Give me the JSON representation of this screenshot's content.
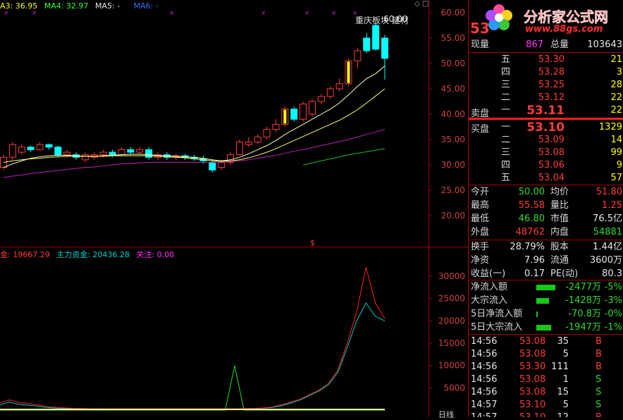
{
  "indicators_top": [
    {
      "label": "A3: 36.95",
      "color": "#ffff00"
    },
    {
      "label": "MA4: 32.97",
      "color": "#33ff33"
    },
    {
      "label": "MA5: -",
      "color": "#e6e6e6"
    },
    {
      "label": "MA6: -",
      "color": "#3b6bff"
    }
  ],
  "indicators_bottom": [
    {
      "label": "金: 19667.29",
      "color": "#ff3b3b"
    },
    {
      "label": "主力资金: 20436.28",
      "color": "#00d0d0"
    },
    {
      "label": "关注: 0.00",
      "color": "#ff33ff"
    }
  ],
  "stock_tag": "重庆板块 建材",
  "stock_tag_price": "60.00",
  "marker_symbol": "$",
  "top_axis_ticks": [
    "60.00",
    "55.00",
    "50.00",
    "45.00",
    "40.00",
    "35.00",
    "30.00",
    "25.00",
    "20.00"
  ],
  "bottom_axis_ticks": [
    "30000",
    "25000",
    "20000",
    "15000",
    "10000",
    "5000"
  ],
  "bottom_corner_label": "日线",
  "logo": {
    "title": "分析家公式网",
    "url": "www.88gs.com",
    "code_fragment": "53"
  },
  "colors": {
    "up": "#ff3b3b",
    "down": "#00ffff",
    "ma_white": "#ffffc0",
    "ma_yellow": "#ffff60",
    "ma_mag": "#c020c0",
    "ma_green": "#20c020",
    "red_line": "#ff2020",
    "cyan_line": "#00c8c8",
    "green_line": "#20e020"
  },
  "quote": {
    "xianliang_label": "现量",
    "xianliang": "867",
    "zongliang_label": "总量",
    "zongliang": "103643",
    "sell_label": "卖盘",
    "buy_label": "买盘",
    "asks": [
      {
        "level": "五",
        "price": "53.30",
        "vol": "21"
      },
      {
        "level": "四",
        "price": "53.28",
        "vol": "3"
      },
      {
        "level": "三",
        "price": "53.25",
        "vol": "28"
      },
      {
        "level": "二",
        "price": "53.12",
        "vol": "22"
      },
      {
        "level": "一",
        "price": "53.11",
        "vol": "22"
      }
    ],
    "bids": [
      {
        "level": "一",
        "price": "53.10",
        "vol": "1329"
      },
      {
        "level": "二",
        "price": "53.09",
        "vol": "14"
      },
      {
        "level": "三",
        "price": "53.08",
        "vol": "99"
      },
      {
        "level": "四",
        "price": "53.06",
        "vol": "9"
      },
      {
        "level": "五",
        "price": "53.04",
        "vol": "57"
      }
    ]
  },
  "stats": [
    {
      "l1": "今开",
      "v1": "50.00",
      "c1": "grn",
      "l2": "均价",
      "v2": "51.80",
      "c2": "red"
    },
    {
      "l1": "最高",
      "v1": "55.58",
      "c1": "red",
      "l2": "量比",
      "v2": "1.25",
      "c2": "red"
    },
    {
      "l1": "最低",
      "v1": "46.80",
      "c1": "grn",
      "l2": "市值",
      "v2": "76.5亿",
      "c2": "wht"
    },
    {
      "l1": "外盘",
      "v1": "48762",
      "c1": "red",
      "l2": "内盘",
      "v2": "54881",
      "c2": "grn"
    }
  ],
  "stats2": [
    {
      "l1": "换手",
      "v1": "28.79%",
      "l2": "股本",
      "v2": "1.44亿"
    },
    {
      "l1": "净资",
      "v1": "7.96",
      "l2": "流通",
      "v2": "3600万"
    },
    {
      "l1": "收益(一)",
      "v1": "0.17",
      "l2": "PE(动)",
      "v2": "80.3"
    }
  ],
  "flows": [
    {
      "label": "净流入额",
      "value": "-2477万",
      "pct": "-5%",
      "bar": 0.9
    },
    {
      "label": "大宗流入",
      "value": "-1428万",
      "pct": "-3%",
      "bar": 0.6
    },
    {
      "label": "5日净流入额",
      "value": "-70.8万",
      "pct": "-0%",
      "bar": 0.05
    },
    {
      "label": "5日大宗流入",
      "value": "-1947万",
      "pct": "-1%",
      "bar": 0.7
    }
  ],
  "ticks": [
    {
      "time": "14:56",
      "price": "53.08",
      "vol": "35",
      "side": "B"
    },
    {
      "time": "14:56",
      "price": "53.08",
      "vol": "5",
      "side": "B"
    },
    {
      "time": "14:56",
      "price": "53.30",
      "vol": "111",
      "side": "B"
    },
    {
      "time": "14:56",
      "price": "53.08",
      "vol": "1",
      "side": "S"
    },
    {
      "time": "14:56",
      "price": "53.08",
      "vol": "15",
      "side": "S"
    },
    {
      "time": "14:57",
      "price": "53.10",
      "vol": "5",
      "side": "S"
    },
    {
      "time": "14:57",
      "price": "53.10",
      "vol": "12",
      "side": "B"
    }
  ],
  "chart_data": {
    "type": "candlestick",
    "ylim": [
      20,
      60
    ],
    "candles": [
      [
        29.5,
        31.5,
        32.0,
        29.0
      ],
      [
        31.5,
        34.0,
        34.5,
        31.0
      ],
      [
        32.5,
        33.5,
        34.0,
        32.0
      ],
      [
        33.5,
        33.0,
        33.8,
        32.5
      ],
      [
        33.0,
        34.0,
        34.5,
        32.8
      ],
      [
        34.0,
        33.5,
        34.2,
        33.0
      ],
      [
        33.5,
        32.0,
        33.8,
        31.5
      ],
      [
        32.0,
        32.5,
        33.0,
        31.5
      ],
      [
        32.0,
        31.5,
        32.5,
        31.0
      ],
      [
        31.0,
        32.0,
        32.5,
        30.5
      ],
      [
        31.5,
        32.0,
        32.5,
        31.0
      ],
      [
        32.0,
        32.5,
        33.0,
        31.5
      ],
      [
        32.5,
        32.0,
        33.0,
        31.5
      ],
      [
        32.0,
        33.0,
        33.5,
        31.8
      ],
      [
        33.0,
        32.5,
        33.5,
        32.0
      ],
      [
        32.5,
        33.0,
        33.5,
        32.0
      ],
      [
        33.0,
        31.5,
        33.5,
        31.0
      ],
      [
        31.5,
        32.0,
        32.5,
        31.0
      ],
      [
        32.0,
        31.5,
        32.5,
        31.0
      ],
      [
        31.5,
        31.8,
        32.2,
        31.0
      ],
      [
        31.8,
        31.5,
        32.2,
        31.0
      ],
      [
        31.5,
        31.2,
        32.0,
        30.8
      ],
      [
        31.2,
        30.8,
        31.8,
        30.2
      ],
      [
        30.5,
        29.0,
        31.0,
        28.5
      ],
      [
        29.5,
        30.5,
        31.0,
        29.0
      ],
      [
        30.5,
        32.0,
        32.5,
        30.0
      ],
      [
        32.0,
        34.5,
        35.0,
        31.8
      ],
      [
        34.0,
        34.5,
        35.5,
        33.5
      ],
      [
        34.5,
        35.5,
        36.0,
        34.0
      ],
      [
        35.5,
        37.0,
        37.5,
        35.0
      ],
      [
        37.0,
        38.0,
        39.0,
        36.5
      ],
      [
        38.0,
        41.0,
        41.5,
        37.5
      ],
      [
        41.0,
        39.0,
        41.5,
        38.5
      ],
      [
        39.0,
        42.0,
        42.5,
        38.5
      ],
      [
        40.0,
        42.5,
        43.0,
        39.5
      ],
      [
        42.5,
        43.5,
        44.0,
        42.0
      ],
      [
        43.5,
        45.0,
        45.5,
        43.0
      ],
      [
        45.0,
        46.0,
        47.0,
        44.5
      ],
      [
        46.0,
        50.5,
        51.0,
        45.5
      ],
      [
        50.5,
        52.5,
        53.0,
        49.0
      ],
      [
        55.0,
        52.5,
        56.0,
        52.0
      ],
      [
        57.5,
        52.8,
        58.0,
        52.5
      ],
      [
        55.0,
        51.0,
        55.6,
        46.8
      ]
    ],
    "ma_white": [
      29.5,
      30.2,
      30.8,
      31.3,
      31.6,
      31.8,
      31.9,
      31.9,
      31.8,
      31.7,
      31.7,
      31.8,
      31.9,
      32.0,
      32.1,
      32.1,
      32.0,
      31.9,
      31.8,
      31.7,
      31.6,
      31.5,
      31.3,
      31.0,
      30.8,
      31.0,
      31.5,
      32.2,
      33.0,
      33.8,
      34.8,
      36.0,
      37.0,
      38.0,
      39.0,
      40.0,
      41.0,
      42.2,
      43.8,
      45.5,
      47.0,
      48.0,
      49.5
    ],
    "ma_yellow": [
      30.5,
      30.8,
      31.0,
      31.2,
      31.3,
      31.5,
      31.6,
      31.7,
      31.7,
      31.7,
      31.7,
      31.7,
      31.8,
      31.8,
      31.8,
      31.8,
      31.8,
      31.7,
      31.6,
      31.5,
      31.4,
      31.2,
      31.0,
      30.8,
      30.7,
      30.8,
      31.0,
      31.4,
      31.9,
      32.5,
      33.2,
      34.0,
      34.8,
      35.6,
      36.4,
      37.2,
      38.0,
      38.8,
      39.8,
      40.9,
      42.2,
      43.6,
      45.0
    ],
    "ma_mag": [
      27.5,
      27.8,
      28.0,
      28.3,
      28.5,
      28.7,
      28.9,
      29.1,
      29.3,
      29.5,
      29.6,
      29.8,
      30.0,
      30.2,
      30.3,
      30.4,
      30.5,
      30.5,
      30.5,
      30.5,
      30.5,
      30.5,
      30.5,
      30.5,
      30.5,
      30.6,
      30.8,
      31.0,
      31.3,
      31.6,
      31.9,
      32.3,
      32.7,
      33.0,
      33.4,
      33.8,
      34.2,
      34.6,
      35.0,
      35.5,
      36.0,
      36.5,
      37.0
    ],
    "ma_green": [
      null,
      null,
      null,
      null,
      null,
      null,
      null,
      null,
      null,
      null,
      null,
      null,
      null,
      null,
      null,
      null,
      null,
      null,
      null,
      null,
      null,
      null,
      null,
      null,
      null,
      null,
      null,
      null,
      null,
      null,
      null,
      null,
      null,
      30.0,
      30.4,
      30.8,
      31.2,
      31.6,
      32.0,
      32.3,
      32.6,
      32.9,
      33.2
    ],
    "flow_ylim": [
      0,
      33000
    ],
    "flow_red": [
      1600,
      2300,
      1700,
      1500,
      1200,
      800,
      600,
      500,
      400,
      350,
      300,
      300,
      300,
      300,
      300,
      300,
      300,
      300,
      300,
      300,
      300,
      300,
      300,
      300,
      300,
      300,
      350,
      400,
      500,
      700,
      1200,
      1800,
      2500,
      3500,
      4500,
      6000,
      9000,
      15000,
      22000,
      32000,
      24000,
      20500
    ],
    "flow_cyan": [
      1200,
      1800,
      1300,
      1100,
      900,
      600,
      450,
      400,
      350,
      300,
      280,
      260,
      260,
      260,
      260,
      260,
      260,
      260,
      260,
      260,
      260,
      260,
      260,
      260,
      260,
      280,
      300,
      350,
      450,
      600,
      1000,
      1600,
      2300,
      3300,
      4300,
      5700,
      8500,
      14000,
      20000,
      24000,
      21000,
      20000
    ],
    "flow_green": [
      0,
      0,
      0,
      0,
      0,
      0,
      0,
      0,
      0,
      0,
      0,
      0,
      0,
      0,
      0,
      0,
      0,
      0,
      0,
      0,
      0,
      0,
      0,
      0,
      0,
      10000,
      0,
      0,
      0,
      0,
      0,
      0,
      0,
      0,
      0,
      0,
      0,
      0,
      0,
      0,
      0,
      0
    ]
  }
}
